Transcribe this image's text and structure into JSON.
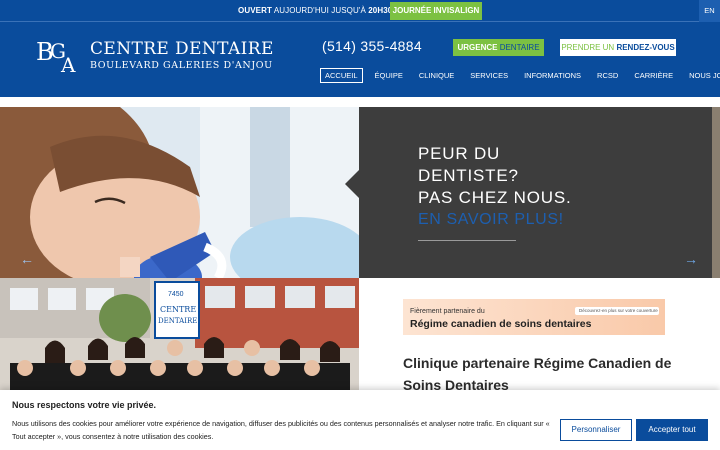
{
  "topbar": {
    "hours_prefix": "OUVERT",
    "hours_mid": " AUJOURD'HUI JUSQU'À ",
    "hours_time": "20H30",
    "invisalign_label": "JOURNÉE INVISALIGN",
    "lang_label": "EN"
  },
  "header": {
    "logo_mark": "BGA",
    "logo_title": "CENTRE DENTAIRE",
    "logo_subtitle": "BOULEVARD GALERIES D'ANJOU",
    "phone": "(514) 355-4884",
    "urgence_a": "URGENCE",
    "urgence_b": " DENTAIRE",
    "rdv_a": "PRENDRE UN ",
    "rdv_b": "RENDEZ-VOUS"
  },
  "nav": {
    "items": [
      {
        "label": "ACCUEIL"
      },
      {
        "label": "ÉQUIPE"
      },
      {
        "label": "CLINIQUE"
      },
      {
        "label": "SERVICES"
      },
      {
        "label": "INFORMATIONS"
      },
      {
        "label": "RCSD"
      },
      {
        "label": "CARRIÈRE"
      },
      {
        "label": "NOUS JOINDRE"
      }
    ]
  },
  "hero": {
    "line1": "PEUR DU",
    "line2": "DENTISTE?",
    "line3": "PAS CHEZ NOUS.",
    "link": "EN SAVOIR PLUS!",
    "prev_icon": "arrow-left-icon",
    "next_icon": "arrow-right-icon"
  },
  "team": {
    "sign_number": "7450",
    "sign_line1": "CENTRE",
    "sign_line2": "DENTAIRE"
  },
  "banner": {
    "line1": "Fièrement partenaire du",
    "line2": "Régime canadien de soins dentaires",
    "pill": "Découvrez-en plus sur votre couverture"
  },
  "section": {
    "title": "Clinique partenaire Régime Canadien de Soins Dentaires"
  },
  "cookie": {
    "title": "Nous respectons votre vie privée.",
    "text": "Nous utilisons des cookies pour améliorer votre expérience de navigation, diffuser des publicités ou des contenus personnalisés et analyser notre trafic. En cliquant sur « Tout accepter », vous consentez à notre utilisation des cookies.",
    "customize": "Personnaliser",
    "accept": "Accepter tout"
  },
  "colors": {
    "brand_blue": "#0a4c9c",
    "accent_green": "#7cc142",
    "hero_panel": "#3d3d3d",
    "link_blue": "#1d5fb0"
  }
}
